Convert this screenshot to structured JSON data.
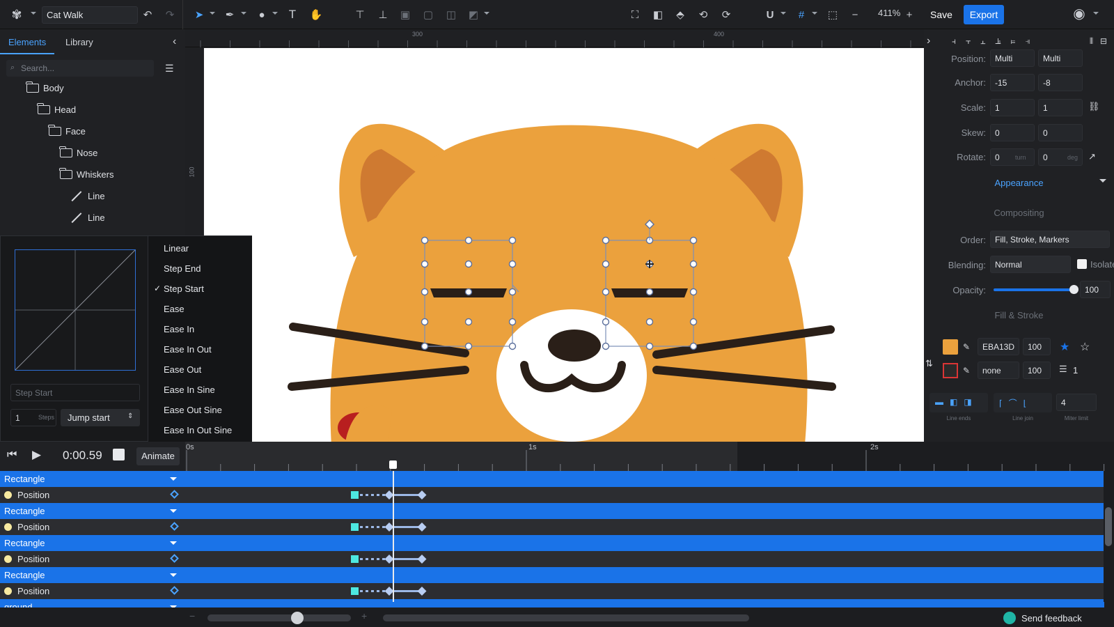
{
  "toolbar": {
    "document_title": "Cat Walk",
    "zoom": "411%",
    "save_label": "Save",
    "export_label": "Export"
  },
  "left_panel": {
    "tabs": [
      {
        "label": "Elements"
      },
      {
        "label": "Library"
      }
    ],
    "search_placeholder": "Search...",
    "tree": [
      {
        "label": "Body",
        "type": "folder"
      },
      {
        "label": "Head",
        "type": "folder"
      },
      {
        "label": "Face",
        "type": "folder"
      },
      {
        "label": "Nose",
        "type": "folder"
      },
      {
        "label": "Whiskers",
        "type": "folder"
      },
      {
        "label": "Line",
        "type": "line"
      },
      {
        "label": "Line",
        "type": "line"
      }
    ]
  },
  "easing_popup": {
    "options": [
      "Linear",
      "Step End",
      "Step Start",
      "Ease",
      "Ease In",
      "Ease In Out",
      "Ease Out",
      "Ease In Sine",
      "Ease Out Sine",
      "Ease In Out Sine"
    ],
    "selected": "Step Start",
    "name_placeholder": "Step Start",
    "steps_value": "1",
    "steps_unit": "Steps",
    "jump_value": "Jump start"
  },
  "rulers": {
    "top": [
      "300",
      "400"
    ],
    "left": [
      "100"
    ]
  },
  "right_panel": {
    "position": {
      "label": "Position:",
      "x": "Multi",
      "y": "Multi"
    },
    "anchor": {
      "label": "Anchor:",
      "x": "-15",
      "y": "-8"
    },
    "scale": {
      "label": "Scale:",
      "x": "1",
      "y": "1"
    },
    "skew": {
      "label": "Skew:",
      "x": "0",
      "y": "0"
    },
    "rotate": {
      "label": "Rotate:",
      "x": "0",
      "x_unit": "turn",
      "y": "0",
      "y_unit": "deg"
    },
    "appearance_label": "Appearance",
    "compositing_title": "Compositing",
    "order": {
      "label": "Order:",
      "value": "Fill, Stroke, Markers"
    },
    "blending": {
      "label": "Blending:",
      "value": "Normal",
      "isolate_label": "Isolate"
    },
    "opacity": {
      "label": "Opacity:",
      "value": "100",
      "fraction": 1.0
    },
    "fill_stroke_title": "Fill & Stroke",
    "fill": {
      "color": "#EBA13D",
      "hex": "EBA13D",
      "opacity": "100"
    },
    "stroke": {
      "value": "none",
      "opacity": "100",
      "width": "1"
    },
    "line_ends_label": "Line ends",
    "line_join_label": "Line join",
    "miter_label": "Miter limit",
    "miter_value": "4"
  },
  "timeline": {
    "time": "0:00.59",
    "animate_label": "Animate",
    "ruler_labels": [
      "0s",
      "1s",
      "2s"
    ],
    "rows": [
      {
        "kind": "object",
        "label": "Rectangle"
      },
      {
        "kind": "property",
        "label": "Position"
      },
      {
        "kind": "object",
        "label": "Rectangle"
      },
      {
        "kind": "property",
        "label": "Position"
      },
      {
        "kind": "object",
        "label": "Rectangle"
      },
      {
        "kind": "property",
        "label": "Position"
      },
      {
        "kind": "object",
        "label": "Rectangle"
      },
      {
        "kind": "property",
        "label": "Position"
      },
      {
        "kind": "object",
        "label": "ground"
      }
    ]
  },
  "status": {
    "feedback_label": "Send feedback"
  },
  "colors": {
    "accent": "#1a73e8",
    "cat_orange": "#EBA13D",
    "keyframe": "#4de8e0"
  }
}
